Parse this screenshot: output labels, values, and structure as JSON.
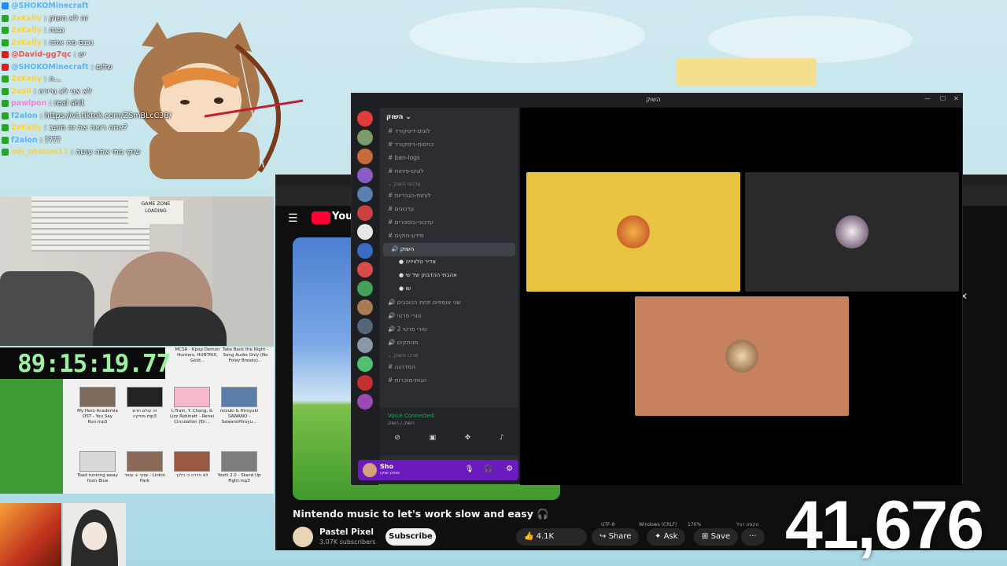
{
  "chat": {
    "lines": [
      {
        "user": "@SHOKOMinecraft",
        "msg": "",
        "color": "#5ab4ff",
        "badge": "#1e90ff"
      },
      {
        "user": "2xKelly",
        "msg": ": זה לא השוק",
        "color": "#ffd23a",
        "badge": "#29a329"
      },
      {
        "user": "2xKelly",
        "msg": ": גבנה",
        "color": "#ffd23a",
        "badge": "#29a329"
      },
      {
        "user": "2xKelly",
        "msg": ": נכנס מה אתה",
        "color": "#ffd23a",
        "badge": "#29a329"
      },
      {
        "user": "@David-gg7qc",
        "msg": ": יש",
        "color": "#ff4f4f",
        "badge": "#d32020"
      },
      {
        "user": "@SHOKOMinecraft",
        "msg": ": שלום",
        "color": "#5ab4ff",
        "badge": "#d32020"
      },
      {
        "user": "2xKelly",
        "msg": ": ה...",
        "color": "#ffd23a",
        "badge": "#29a329"
      },
      {
        "user": "2vall",
        "msg": ": לא אני לא גרירה",
        "color": "#ffd23a",
        "badge": "#29a329"
      },
      {
        "user": "pawlpon",
        "msg": ": real shit",
        "color": "#ff7ad9",
        "badge": "#29a329"
      },
      {
        "user": "f2alon",
        "msg": ": https://vt.tiktok.com/ZSmBLcC3B/",
        "color": "#5ab4ff",
        "badge": "#29a329"
      },
      {
        "user": "2xKelly",
        "msg": ": אתה רואה את זה חושב?",
        "color": "#ffd23a",
        "badge": "#29a329"
      },
      {
        "user": "f2alon",
        "msg": ": ????",
        "color": "#5ab4ff",
        "badge": "#29a329"
      },
      {
        "user": "adi_shalom12",
        "msg": ": שוקי מתי אתה עושה",
        "color": "#ffd23a",
        "badge": "#29a329"
      }
    ]
  },
  "webcam": {
    "poster_line1": "GAME ZONE",
    "poster_line2": "LOADING"
  },
  "timer": "89:15:19.77",
  "media": {
    "thumbs": [
      {
        "title": "My Hero Academia OST - You Say Run.mp3",
        "color": "#7d6a5a"
      },
      {
        "title": "זה עולם חדש מוזיקה.mp3",
        "color": "#222222"
      },
      {
        "title": "L-Train, Y. Chang, & Lizz Robinett - Renai Circulation (En...",
        "color": "#f4b8c8"
      },
      {
        "title": "mizuki & Hiroyuki SAWANO - SawanoHiroyu...",
        "color": "#5a7ea8"
      },
      {
        "title": "Toad running away from Blue",
        "color": "#d8d8d8"
      },
      {
        "title": "שוקי + עומר - Linkin Park",
        "color": "#8a6a56"
      },
      {
        "title": "לא הדרה כי כלכך",
        "color": "#9a5a42"
      },
      {
        "title": "Yoshi 2.0 - Stand Up Fight.mp3",
        "color": "#7d7d7d"
      }
    ],
    "top_labels": [
      "MCSR - Kpop Demon Hunters, HUNTRIX, Gold...",
      "Take Back the Night - Song Audio Only (No Foley Breaks)..."
    ]
  },
  "youtube": {
    "logo_text": "YouTube",
    "video_title": "Nintendo music to let's work slow and easy 🎧",
    "channel": "Pastel Pixel",
    "subscribers": "3.07K subscribers",
    "subscribe_label": "Subscribe",
    "likes": "4.1K",
    "share_label": "Share",
    "ask_label": "Ask",
    "save_label": "Save",
    "more_label": "···",
    "status": [
      "UTF-8",
      "Windows (CRLF)",
      "170%",
      "טקסט רגיל"
    ]
  },
  "big_count": "41,676",
  "discord": {
    "window_title": "השוק",
    "server_name": "השוק",
    "channels": [
      {
        "name": "לוגים-דיסקורד",
        "kind": "text",
        "cls": ""
      },
      {
        "name": "כניסות-דיסקורד",
        "kind": "text",
        "cls": ""
      },
      {
        "name": "ban-logs",
        "kind": "text",
        "cls": ""
      },
      {
        "name": "לוגים-פיתוח",
        "kind": "text",
        "cls": ""
      },
      {
        "name": "עדכוני השוק",
        "kind": "category",
        "cls": "cat"
      },
      {
        "name": "לוחות-הגבריות",
        "kind": "text",
        "cls": ""
      },
      {
        "name": "עדכונים",
        "kind": "text",
        "cls": ""
      },
      {
        "name": "עדכוני-בוסטרים",
        "kind": "text",
        "cls": ""
      },
      {
        "name": "מידע-חוקים",
        "kind": "text",
        "cls": ""
      },
      {
        "name": "השוק",
        "kind": "voice",
        "cls": "active"
      },
      {
        "name": "אדיר טלוויזיה",
        "kind": "user",
        "cls": "user"
      },
      {
        "name": "אהבתי ההדבוק של שי",
        "kind": "user",
        "cls": "user"
      },
      {
        "name": "שו",
        "kind": "user",
        "cls": "user"
      },
      {
        "name": "שני אוספים תחת הכוכבים",
        "kind": "voice",
        "cls": ""
      },
      {
        "name": "טורי פרטי",
        "kind": "voice",
        "cls": ""
      },
      {
        "name": "טורי פרטי 2",
        "kind": "voice",
        "cls": ""
      },
      {
        "name": "מנותקים",
        "kind": "voice",
        "cls": ""
      },
      {
        "name": "מרכז השוק",
        "kind": "category",
        "cls": "cat"
      },
      {
        "name": "המדרגה",
        "kind": "text",
        "cls": ""
      },
      {
        "name": "הגות-מזכרות",
        "kind": "text",
        "cls": ""
      }
    ],
    "voice_connected": "Voice Connected",
    "voice_channel": "השוק / השוק",
    "user_name": "Sho",
    "user_status": "שומע שוקו",
    "server_colors": [
      "#e23b3b",
      "#7a9c6a",
      "#c76b3a",
      "#8a5cc4",
      "#5a7fb3",
      "#c94040",
      "#e8e8e8",
      "#3b6ac2",
      "#d94b4b",
      "#44a05a",
      "#aa7a52",
      "#556677",
      "#8899aa",
      "#4fc06b",
      "#c23030",
      "#9a4ab0"
    ],
    "tile_colors": [
      "#e8c440",
      "#2a2a2a",
      "#c8815e"
    ]
  }
}
